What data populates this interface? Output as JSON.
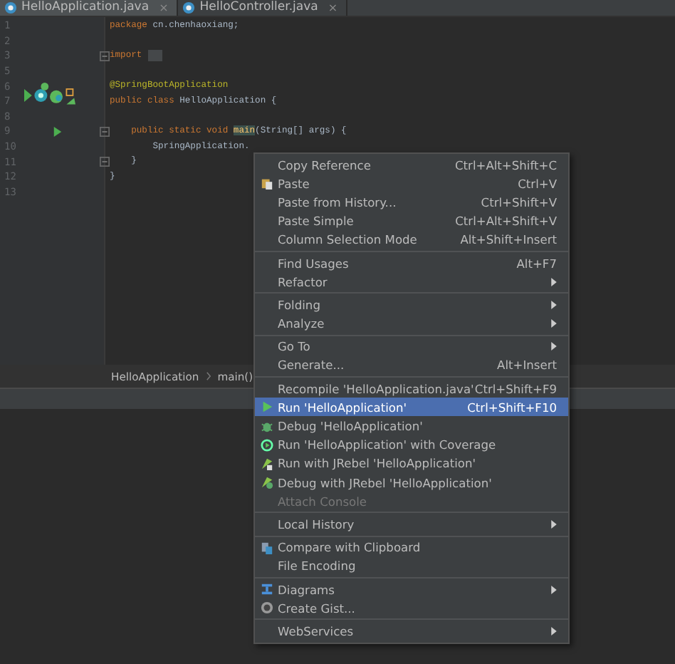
{
  "tabs": [
    {
      "label": "HelloApplication.java",
      "close": "×",
      "selected": true
    },
    {
      "label": "HelloController.java",
      "close": "×",
      "selected": false
    }
  ],
  "editor": {
    "lines": [
      {
        "number": "1",
        "tokens": [
          {
            "kind": "keyword",
            "text": "package"
          },
          {
            "kind": "plain",
            "text": " cn.chenhaoxiang;"
          }
        ]
      },
      {
        "number": "2"
      },
      {
        "number": "3",
        "fold": true,
        "folded": true,
        "tokens": [
          {
            "kind": "keyword",
            "text": "import"
          }
        ]
      },
      {
        "number": "5"
      },
      {
        "number": "6",
        "tokens": [
          {
            "kind": "annotation",
            "text": "@SpringBootApplication"
          }
        ]
      },
      {
        "number": "7",
        "kind": "class",
        "tokens": [
          {
            "kind": "keyword",
            "text": "public class"
          },
          {
            "kind": "plain",
            "text": " HelloApplication {"
          }
        ]
      },
      {
        "number": "8"
      },
      {
        "number": "9",
        "kind": "run",
        "fold": true,
        "tokens": [
          {
            "kind": "keyword",
            "text": "    public static void "
          },
          {
            "kind": "method",
            "text": "main"
          },
          {
            "kind": "plain",
            "text": "(String[] args) {"
          }
        ]
      },
      {
        "number": "10",
        "tokens": [
          {
            "kind": "plain",
            "text": "        SpringApplication."
          }
        ]
      },
      {
        "number": "11",
        "fold": true,
        "tokens": [
          {
            "kind": "plain",
            "text": "    }"
          }
        ]
      },
      {
        "number": "12",
        "tokens": [
          {
            "kind": "plain",
            "text": "}"
          }
        ]
      },
      {
        "number": "13"
      }
    ]
  },
  "breadcrumb": [
    "HelloApplication",
    "main()"
  ],
  "context_menu": {
    "groups": [
      [
        {
          "kind": "plain",
          "label": "Copy Reference",
          "shortcut": "Ctrl+Alt+Shift+C",
          "submenu": false,
          "disabled": false,
          "selected": false
        },
        {
          "kind": "paste",
          "label": "Paste",
          "shortcut": "Ctrl+V",
          "submenu": false,
          "disabled": false,
          "selected": false
        },
        {
          "kind": "plain",
          "label": "Paste from History...",
          "shortcut": "Ctrl+Shift+V",
          "submenu": false,
          "disabled": false,
          "selected": false
        },
        {
          "kind": "plain",
          "label": "Paste Simple",
          "shortcut": "Ctrl+Alt+Shift+V",
          "submenu": false,
          "disabled": false,
          "selected": false
        },
        {
          "kind": "plain",
          "label": "Column Selection Mode",
          "shortcut": "Alt+Shift+Insert",
          "submenu": false,
          "disabled": false,
          "selected": false
        }
      ],
      [
        {
          "kind": "plain",
          "label": "Find Usages",
          "shortcut": "Alt+F7",
          "submenu": false,
          "disabled": false,
          "selected": false
        },
        {
          "kind": "plain",
          "label": "Refactor",
          "submenu": true,
          "disabled": false,
          "selected": false
        }
      ],
      [
        {
          "kind": "plain",
          "label": "Folding",
          "submenu": true,
          "disabled": false,
          "selected": false
        },
        {
          "kind": "plain",
          "label": "Analyze",
          "submenu": true,
          "disabled": false,
          "selected": false
        }
      ],
      [
        {
          "kind": "plain",
          "label": "Go To",
          "submenu": true,
          "disabled": false,
          "selected": false
        },
        {
          "kind": "plain",
          "label": "Generate...",
          "shortcut": "Alt+Insert",
          "submenu": false,
          "disabled": false,
          "selected": false
        }
      ],
      [
        {
          "kind": "plain",
          "label": "Recompile 'HelloApplication.java'",
          "shortcut": "Ctrl+Shift+F9",
          "submenu": false,
          "disabled": false,
          "selected": false
        },
        {
          "kind": "run",
          "label": "Run 'HelloApplication'",
          "shortcut": "Ctrl+Shift+F10",
          "submenu": false,
          "disabled": false,
          "selected": true
        },
        {
          "kind": "debug",
          "label": "Debug 'HelloApplication'",
          "submenu": false,
          "disabled": false,
          "selected": false
        },
        {
          "kind": "coverage",
          "label": "Run 'HelloApplication' with Coverage",
          "submenu": false,
          "disabled": false,
          "selected": false
        },
        {
          "kind": "jrebel-run",
          "label": "Run with JRebel 'HelloApplication'",
          "submenu": false,
          "disabled": false,
          "selected": false
        },
        {
          "kind": "jrebel-debug",
          "label": "Debug with JRebel 'HelloApplication'",
          "submenu": false,
          "disabled": false,
          "selected": false
        },
        {
          "kind": "plain",
          "label": "Attach Console",
          "submenu": false,
          "disabled": true,
          "selected": false
        }
      ],
      [
        {
          "kind": "plain",
          "label": "Local History",
          "submenu": true,
          "disabled": false,
          "selected": false
        }
      ],
      [
        {
          "kind": "compare",
          "label": "Compare with Clipboard",
          "submenu": false,
          "disabled": false,
          "selected": false
        },
        {
          "kind": "plain",
          "label": "File Encoding",
          "submenu": false,
          "disabled": false,
          "selected": false
        }
      ],
      [
        {
          "kind": "diagrams",
          "label": "Diagrams",
          "submenu": true,
          "disabled": false,
          "selected": false
        },
        {
          "kind": "gist",
          "label": "Create Gist...",
          "submenu": false,
          "disabled": false,
          "selected": false
        }
      ],
      [
        {
          "kind": "plain",
          "label": "WebServices",
          "submenu": true,
          "disabled": false,
          "selected": false
        }
      ]
    ]
  }
}
